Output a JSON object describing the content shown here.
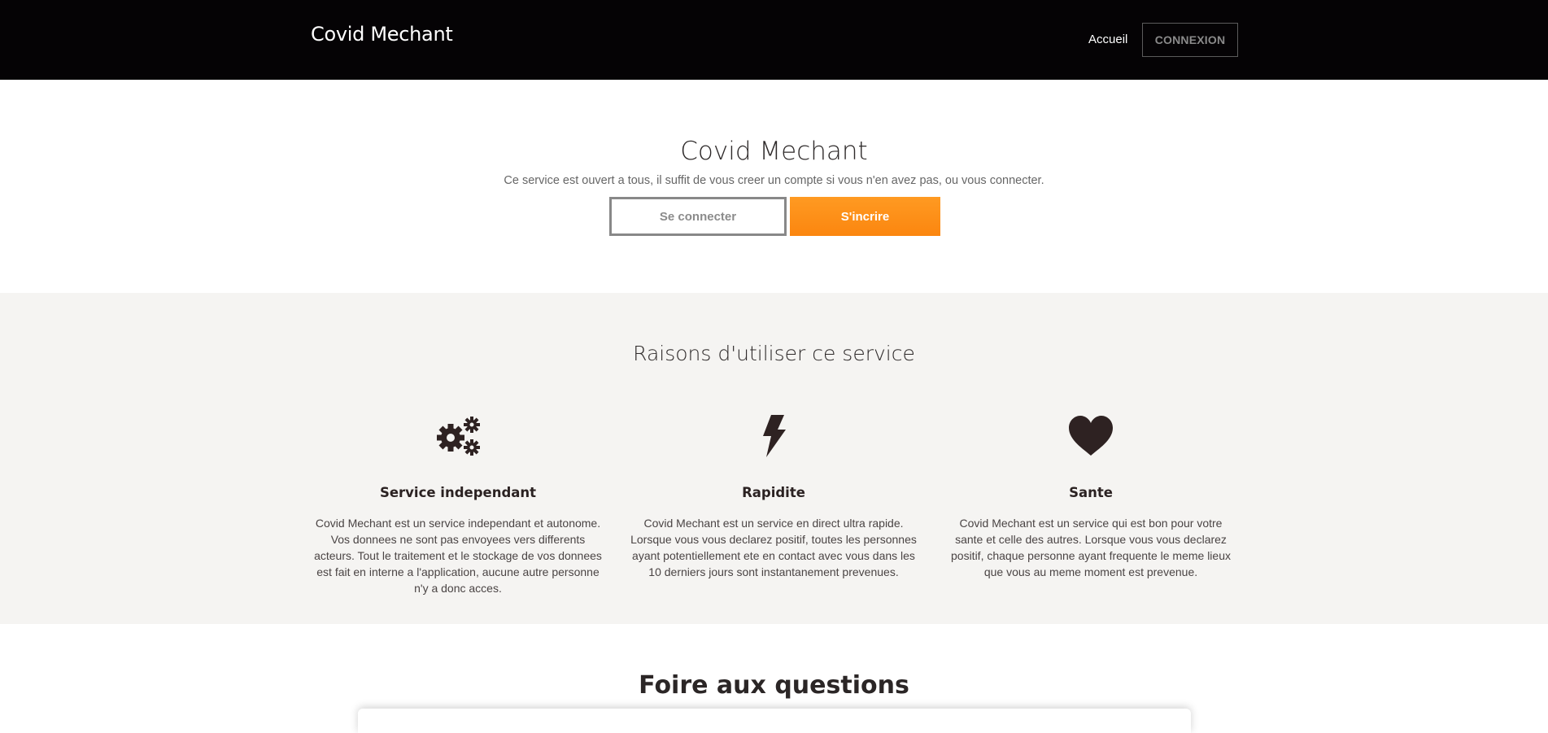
{
  "navbar": {
    "brand": "Covid Mechant",
    "home_link": "Accueil",
    "login_button": "CONNEXION"
  },
  "hero": {
    "title": "Covid Mechant",
    "subtitle": "Ce service est ouvert a tous, il suffit de vous creer un compte si vous n'en avez pas, ou vous connecter.",
    "login_button": "Se connecter",
    "signup_button": "S'incrire"
  },
  "features": {
    "title": "Raisons d'utiliser ce service",
    "items": [
      {
        "icon": "gears-icon",
        "title": "Service independant",
        "text": "Covid Mechant est un service independant et autonome. Vos donnees ne sont pas envoyees vers differents acteurs. Tout le traitement et le stockage de vos donnees est fait en interne a l'application, aucune autre personne n'y a donc acces."
      },
      {
        "icon": "lightning-bolt-icon",
        "title": "Rapidite",
        "text": "Covid Mechant est un service en direct ultra rapide. Lorsque vous vous declarez positif, toutes les personnes ayant potentiellement ete en contact avec vous dans les 10 derniers jours sont instantanement prevenues."
      },
      {
        "icon": "heart-icon",
        "title": "Sante",
        "text": "Covid Mechant est un service qui est bon pour votre sante et celle des autres. Lorsque vous vous declarez positif, chaque personne ayant frequente le meme lieux que vous au meme moment est prevenue."
      }
    ]
  },
  "faq": {
    "title": "Foire aux questions"
  },
  "colors": {
    "navbar_bg": "#050305",
    "accent": "#fb8c14",
    "features_bg": "#f5f4f2",
    "icon": "#2e2222"
  }
}
